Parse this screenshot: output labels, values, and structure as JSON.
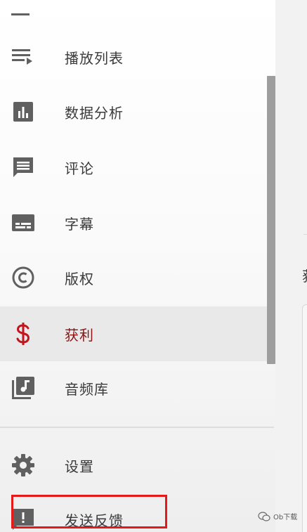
{
  "sidebar": {
    "items": [
      {
        "label": "播放列表",
        "icon": "playlist-icon"
      },
      {
        "label": "数据分析",
        "icon": "analytics-icon"
      },
      {
        "label": "评论",
        "icon": "comments-icon"
      },
      {
        "label": "字幕",
        "icon": "subtitles-icon"
      },
      {
        "label": "版权",
        "icon": "copyright-icon"
      },
      {
        "label": "获利",
        "icon": "monetization-icon",
        "active": true
      },
      {
        "label": "音频库",
        "icon": "audio-library-icon"
      },
      {
        "label": "设置",
        "icon": "settings-icon"
      },
      {
        "label": "发送反馈",
        "icon": "feedback-icon"
      }
    ]
  },
  "right_panel": {
    "partial_text": "获"
  },
  "watermark": {
    "text": "Ob下载"
  },
  "colors": {
    "active_text": "#8a1313",
    "active_icon": "#c2151f",
    "highlight_border": "#e51919",
    "icon_gray": "#606060"
  }
}
